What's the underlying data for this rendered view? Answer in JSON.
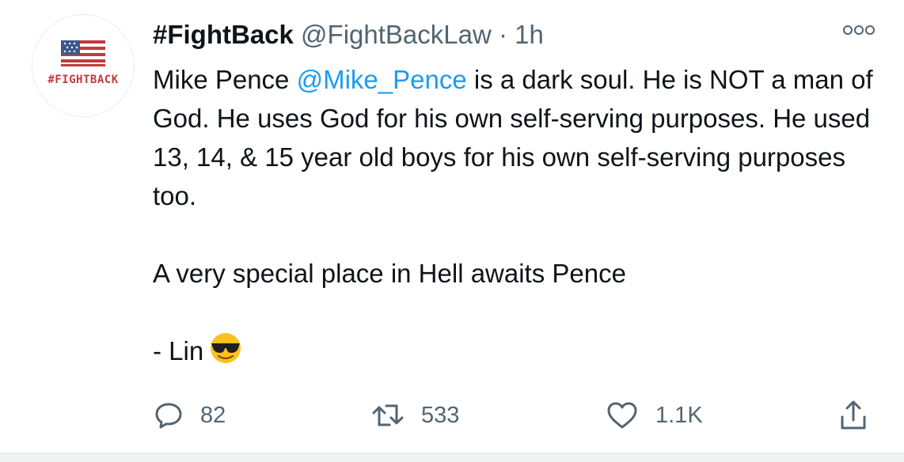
{
  "tweet": {
    "display_name": "#FightBack",
    "handle": "@FightBackLaw",
    "separator": "·",
    "time": "1h",
    "avatar_text": "#FIGHTBACK",
    "body": {
      "line1_a": "Mike Pence ",
      "mention": "@Mike_Pence",
      "line1_b": " is a dark soul. He is NOT a man of God. He uses God for his own self-serving purposes. He used 13, 14, & 15 year old boys for his own self-serving purposes too.",
      "para2": "A very special place in Hell awaits Pence",
      "para3": "- Lin"
    },
    "emoji_icon": "sunglasses-face-icon",
    "actions": {
      "reply_count": "82",
      "retweet_count": "533",
      "like_count": "1.1K"
    }
  },
  "colors": {
    "text": "#0f1419",
    "muted": "#536471",
    "mention": "#1d9bf0",
    "avatar_red": "#c33a3f"
  }
}
